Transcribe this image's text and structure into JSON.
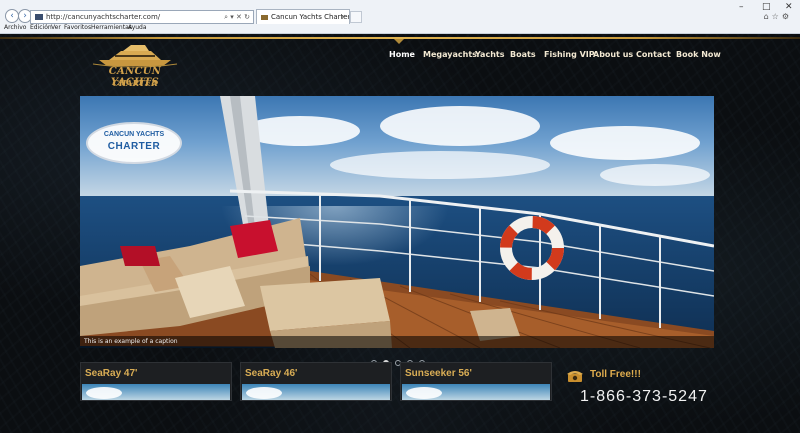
{
  "browser": {
    "url": "http://cancunyachtscharter.com/",
    "tab_title": "Cancun Yachts Charter, Vac...",
    "menu": [
      "Archivo",
      "Edición",
      "Ver",
      "Favoritos",
      "Herramientas",
      "Ayuda"
    ],
    "win_min": "–",
    "win_max": "□",
    "win_close": "✕"
  },
  "site": {
    "logo_line1": "CANCUN YACHTS",
    "logo_line2": "CHARTER",
    "nav": [
      "Home",
      "Megayachts",
      "Yachts",
      "Boats",
      "Fishing VIP",
      "About us",
      "Contact",
      "Book Now"
    ],
    "active_nav": "Home",
    "hero": {
      "logo_line1": "CANCUN YACHTS",
      "logo_line2": "CHARTER",
      "caption": "This is an example of a caption"
    },
    "slider_dots": 5,
    "slider_active": 1,
    "cards": [
      {
        "title": "SeaRay 47'"
      },
      {
        "title": "SeaRay 46'"
      },
      {
        "title": "Sunseeker 56'"
      }
    ],
    "toll_free_label": "Toll Free!!!",
    "phone": "1-866-373-5247"
  },
  "colors": {
    "gold": "#d9ad55",
    "nav_text": "#f2e8d2",
    "background": "#0b0e11"
  }
}
